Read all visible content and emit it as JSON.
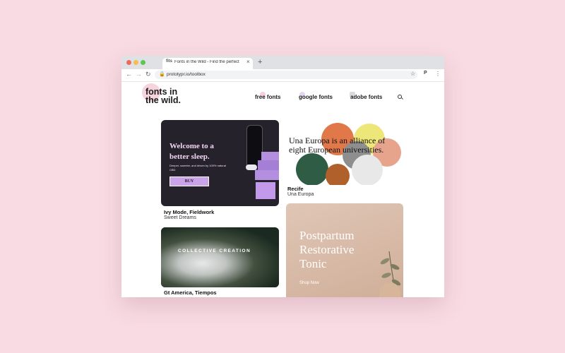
{
  "browser": {
    "tab_favicon": "fits",
    "tab_title": "Fonts in the Wild - Find the perfect",
    "tab_close": "×",
    "new_tab": "+",
    "back": "←",
    "forward": "→",
    "reload": "↻",
    "lock": "🔒",
    "url": "prototypr.io/toolbox",
    "star": "☆",
    "extension": "P",
    "menu": "⋮"
  },
  "colors": {
    "background": "#f9dbe3",
    "close": "#ed6a5e",
    "minimize": "#f5bf4f",
    "maximize": "#61c554"
  },
  "site": {
    "logo_line1": "fonts in",
    "logo_line2": "the wild.",
    "nav": [
      "free fonts",
      "google fonts",
      "adobe fonts"
    ],
    "search_icon": "search-icon"
  },
  "cards": {
    "ivy": {
      "headline": "Welcome to a better sleep.",
      "subtext": "Deeper, sweeter, and driven by 100% natural CBD",
      "button": "BUY",
      "title": "Ivy Mode, Fieldwork",
      "subtitle": "Sweet Dreams"
    },
    "recife": {
      "headline": "Una Europa is an alliance of eight European universities.",
      "title": "Recife",
      "subtitle": "Una Europa"
    },
    "collective": {
      "headline": "COLLECTIVE CREATION",
      "title": "Gt America, Tiempos"
    },
    "postpartum": {
      "headline": "Postpartum Restorative Tonic",
      "cta": "Shop Now"
    }
  }
}
